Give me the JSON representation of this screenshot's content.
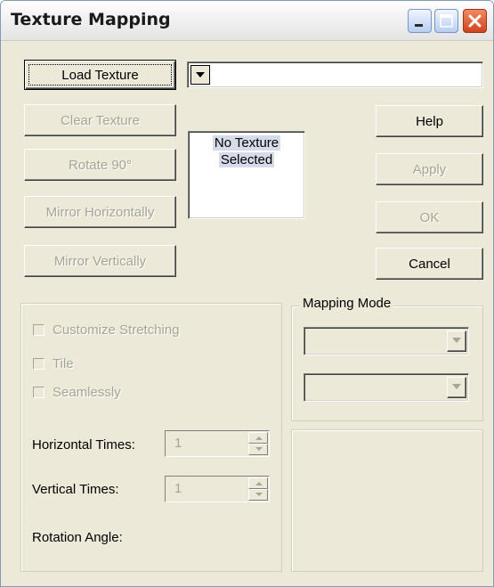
{
  "window": {
    "title": "Texture Mapping"
  },
  "buttons": {
    "load_texture": "Load Texture",
    "clear_texture": "Clear Texture",
    "rotate_90": "Rotate 90°",
    "mirror_horizontally": "Mirror Horizontally",
    "mirror_vertically": "Mirror Vertically",
    "help": "Help",
    "apply": "Apply",
    "ok": "OK",
    "cancel": "Cancel"
  },
  "texture_combo": {
    "value": ""
  },
  "preview": {
    "line1": "No Texture",
    "line2": "Selected"
  },
  "options": {
    "customize_stretching": "Customize Stretching",
    "tile": "Tile",
    "seamlessly": "Seamlessly",
    "horizontal_times_label": "Horizontal Times:",
    "horizontal_times_value": "1",
    "vertical_times_label": "Vertical Times:",
    "vertical_times_value": "1",
    "rotation_angle_label": "Rotation Angle:"
  },
  "mapping_mode": {
    "legend": "Mapping Mode",
    "combo1_value": "",
    "combo2_value": ""
  },
  "icons": {
    "minimize": "minimize-icon",
    "maximize": "maximize-icon",
    "close": "close-icon",
    "dropdown": "chevron-down-icon"
  }
}
